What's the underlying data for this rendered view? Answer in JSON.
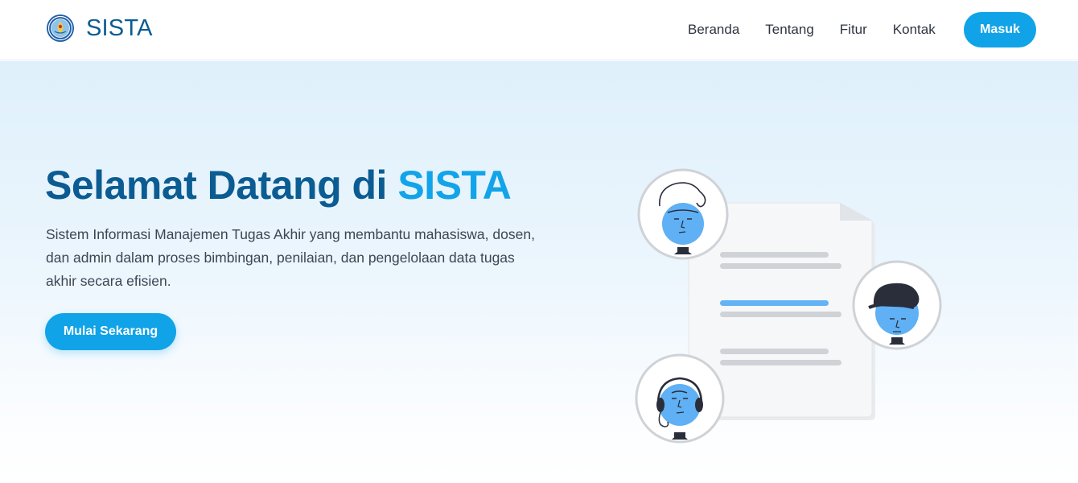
{
  "header": {
    "brand": "SISTA",
    "logo_icon": "university-seal-icon",
    "nav": [
      "Beranda",
      "Tentang",
      "Fitur",
      "Kontak"
    ],
    "login_label": "Masuk"
  },
  "hero": {
    "title_main": "Selamat Datang di ",
    "title_accent": "SISTA",
    "description": "Sistem Informasi Manajemen Tugas Akhir yang membantu mahasiswa, dosen, dan admin dalam proses bimbingan, penilaian, dan pengelolaan data tugas akhir secara efisien.",
    "cta_label": "Mulai Sekarang"
  },
  "illustration": {
    "name": "people-document-illustration",
    "avatars": [
      "student-avatar",
      "lecturer-avatar-cap",
      "admin-avatar-headset"
    ]
  },
  "colors": {
    "brand_dark": "#0b5c92",
    "accent": "#12a4e9",
    "button": "#10a3e8",
    "hero_bg_top": "#dff0fb",
    "text": "#3d4654"
  }
}
